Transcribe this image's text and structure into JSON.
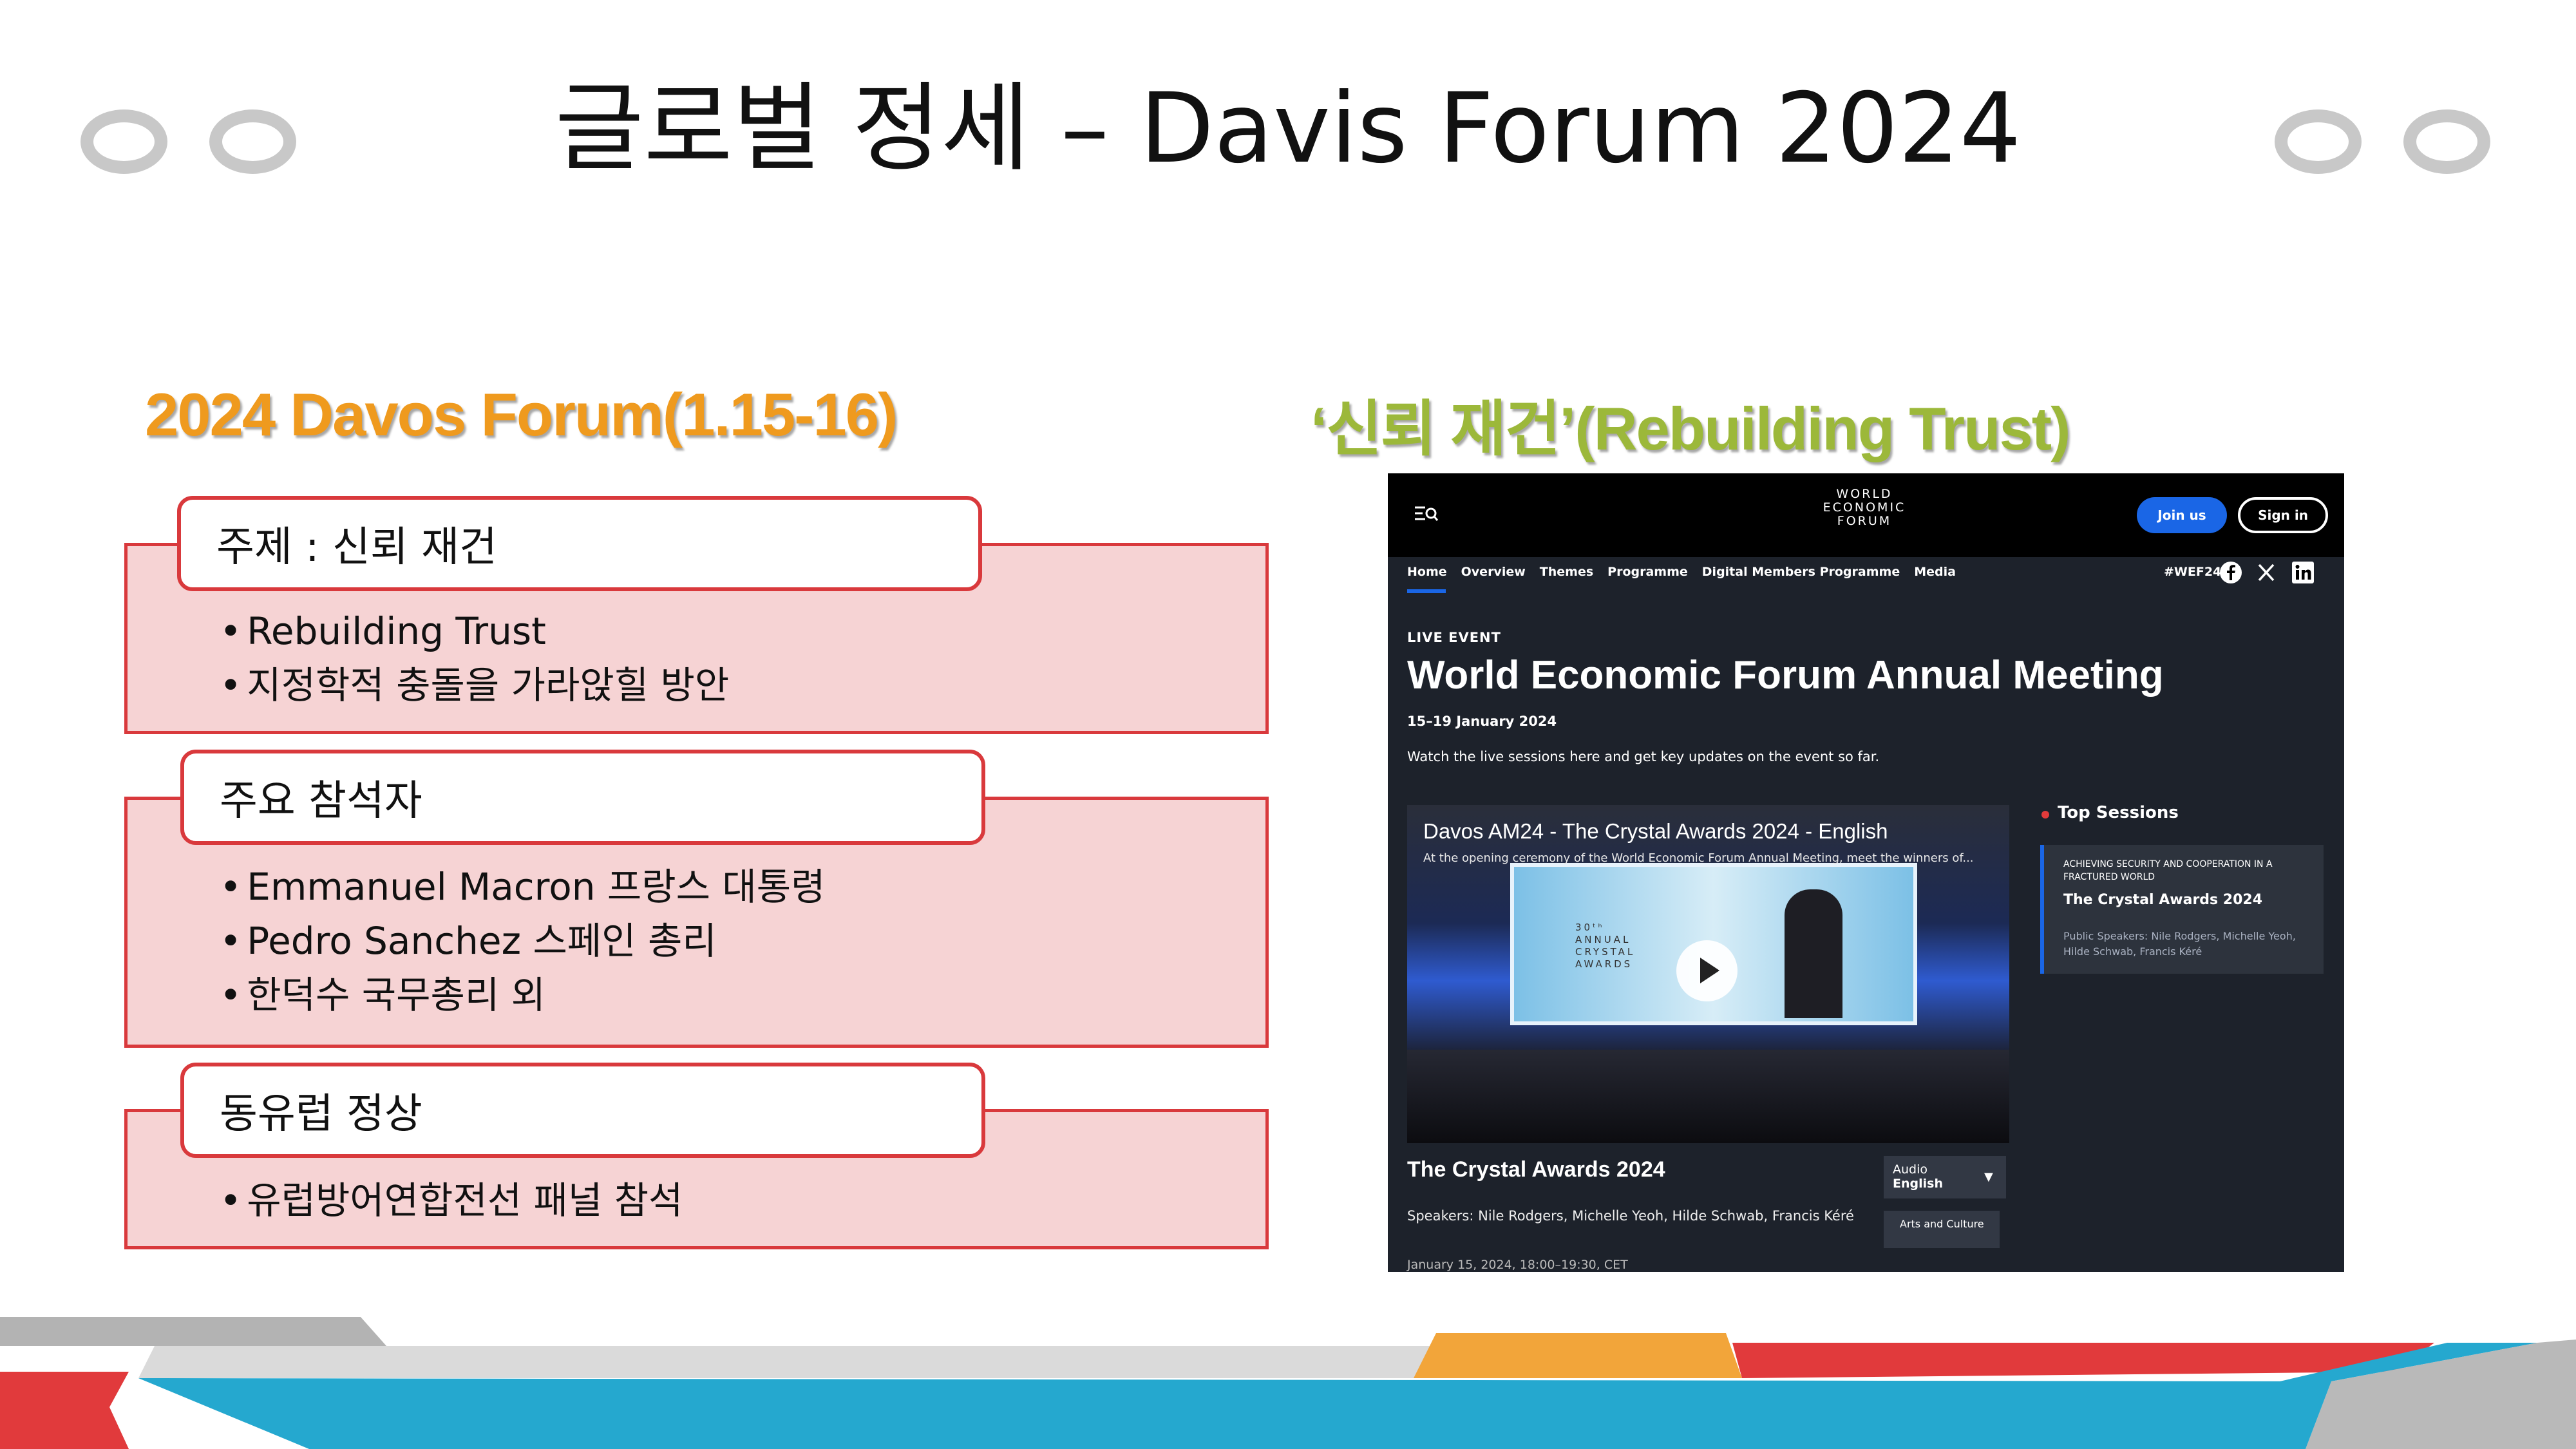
{
  "title": "글로벌 정세 – Davis Forum 2024",
  "left": {
    "heading": "2024 Davos Forum(1.15-16)",
    "panels": [
      {
        "tab": "주제 : 신뢰 재건",
        "bullets": [
          "Rebuilding Trust",
          "지정학적 충돌을 가라앉힐 방안"
        ]
      },
      {
        "tab": "주요 참석자",
        "bullets": [
          "Emmanuel Macron 프랑스 대통령",
          "Pedro Sanchez 스페인 총리",
          "한덕수 국무총리 외"
        ]
      },
      {
        "tab": "동유럽 정상",
        "bullets": [
          "유럽방어연합전선 패널 참석"
        ]
      }
    ]
  },
  "right": {
    "heading": "‘신뢰 재건’(Rebuilding Trust)"
  },
  "site": {
    "logo_lines": [
      "WORLD",
      "ECONOMIC",
      "FORUM"
    ],
    "menu_icon": "menu-search-icon",
    "join": "Join us",
    "sign_in": "Sign in",
    "nav": [
      "Home",
      "Overview",
      "Themes",
      "Programme",
      "Digital Members Programme",
      "Media"
    ],
    "hashtag": "#WEF24",
    "social_icons": [
      "facebook-icon",
      "x-icon",
      "linkedin-icon"
    ],
    "live": "LIVE EVENT",
    "event_title": "World Economic Forum Annual Meeting",
    "dates": "15–19 January 2024",
    "watch": "Watch the live sessions here and get key updates on the event so far.",
    "video": {
      "title": "Davos AM24 - The Crystal Awards 2024 - English",
      "subtitle": "At the opening ceremony of the World Economic Forum Annual Meeting, meet the winners of...",
      "screen_text": "30ᵗʰ ANNUAL CRYSTAL AWARDS"
    },
    "session_title": "The Crystal Awards 2024",
    "speakers": "Speakers: Nile Rodgers, Michelle Yeoh, Hilde Schwab, Francis Kéré",
    "datetime": "January 15, 2024, 18:00–19:30, CET",
    "audio_label": "Audio",
    "audio_value": "English",
    "arts": "Arts and Culture",
    "top_sessions": "Top Sessions",
    "card": {
      "overline": "ACHIEVING SECURITY AND COOPERATION IN A FRACTURED WORLD",
      "title": "The Crystal Awards 2024",
      "speakers": "Public Speakers: Nile Rodgers, Michelle Yeoh, Hilde Schwab, Francis Kéré"
    }
  },
  "colors": {
    "accent_orange": "#ef9a1e",
    "accent_green": "#9cb83a",
    "panel_border": "#d9393c",
    "panel_fill": "#f6d3d4",
    "wef_blue": "#1a66e6"
  }
}
